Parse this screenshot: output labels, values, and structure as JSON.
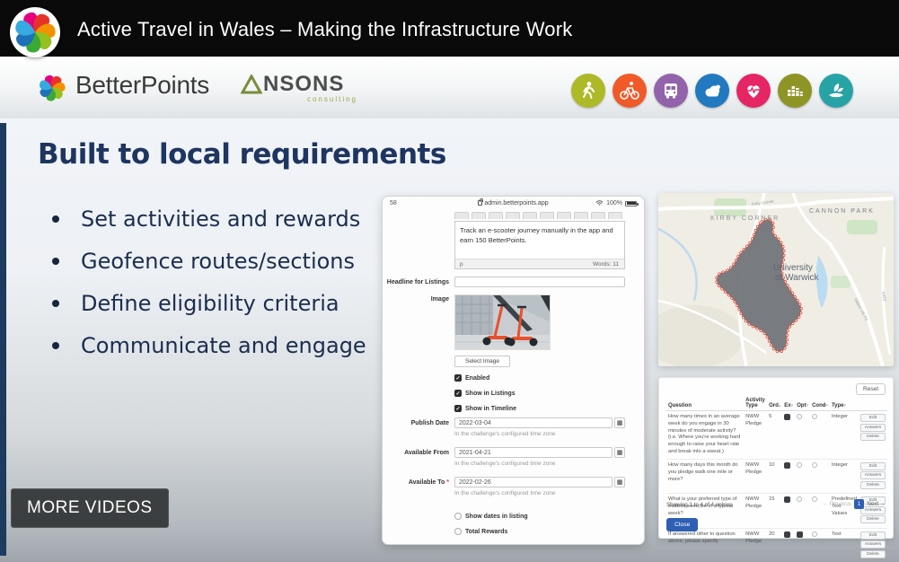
{
  "player": {
    "title": "Active Travel in Wales – Making the Infrastructure Work",
    "more_videos": "MORE VIDEOS"
  },
  "header": {
    "brand": "BetterPoints",
    "partner_rest": "NSONS",
    "partner_sub": "consulting",
    "icons": [
      {
        "name": "walking-icon",
        "color": "#aeb927"
      },
      {
        "name": "cycling-icon",
        "color": "#f05a28"
      },
      {
        "name": "bus-icon",
        "color": "#9263ab"
      },
      {
        "name": "cloud-weather-icon",
        "color": "#2279bf"
      },
      {
        "name": "heart-health-icon",
        "color": "#e62565"
      },
      {
        "name": "bar-chart-icon",
        "color": "#8f9426"
      },
      {
        "name": "eco-leaf-icon",
        "color": "#27a3a6"
      }
    ]
  },
  "slide": {
    "heading": "Built to local requirements",
    "bullets": [
      "Set activities and rewards",
      "Geofence routes/sections",
      "Define eligibility criteria",
      "Communicate and engage"
    ],
    "accent_color": "#1e3560"
  },
  "glyphs": {
    "sort_asc": "▴",
    "sort_desc": "▾",
    "calendar": "▦",
    "check": "✓"
  },
  "admin_form": {
    "status_left": "58",
    "url": "admin.betterpoints.app",
    "battery": "100%",
    "editor_text": "Track an e-scooter journey manually in the app and earn 150 BetterPoints.",
    "editor_path": "p",
    "word_count": "Words: 11",
    "headline_label": "Headline for Listings",
    "headline_value": "",
    "image_label": "Image",
    "select_image_label": "Select Image",
    "checks": [
      {
        "label": "Enabled",
        "checked": true
      },
      {
        "label": "Show in Listings",
        "checked": true
      },
      {
        "label": "Show in Timeline",
        "checked": true
      }
    ],
    "dates": [
      {
        "label": "Publish Date",
        "required": "",
        "value": "2022-03-04",
        "helper": "In the challenge's configured time zone"
      },
      {
        "label": "Available From",
        "required": "",
        "value": "2021-04-21",
        "helper": "In the challenge's configured time zone"
      },
      {
        "label": "Available To",
        "required": "*",
        "value": "2022-02-26",
        "helper": "In the challenge's configured time zone"
      }
    ],
    "bottom_checks": [
      {
        "label": "Show dates in listing",
        "checked": false
      },
      {
        "label": "Total Rewards",
        "checked": false
      }
    ]
  },
  "map": {
    "area_label_1": "KIRBY CORNER",
    "area_label_2": "CANNON PARK",
    "place_line_1": "University",
    "place_line_2": "of Warwick",
    "road_label_1": "Kirby Corner",
    "road_label_2": "Gibbet Hill Rd",
    "road_label_3": "A429",
    "geofence_fill": "#6e7control4",
    "geofence_border": "#e8442e"
  },
  "questions_table": {
    "reset_label": "Reset",
    "columns": [
      "Question",
      "Activity Type",
      "Ord",
      "Ex",
      "Opt",
      "Cond",
      "Type"
    ],
    "rows": [
      {
        "question": "How many times in an average week do you engage in 30 minutes of moderate activity? (i.e. Where you're working hard enough to raise your heart rate and break into a sweat.)",
        "activity": "NWW Pledge",
        "ord": "5",
        "ex": true,
        "opt": false,
        "cond": false,
        "type": "Integer",
        "actions": [
          "Edit",
          "Answers",
          "Delete"
        ]
      },
      {
        "question": "How many days this month do you pledge walk one mile or more?",
        "activity": "NWW Pledge",
        "ord": "10",
        "ex": true,
        "opt": false,
        "cond": false,
        "type": "Integer",
        "actions": [
          "Edit",
          "Answers",
          "Delete"
        ]
      },
      {
        "question": "What is your preferred type of outdoor exercise in a typical week?",
        "activity": "NWW Pledge",
        "ord": "15",
        "ex": true,
        "opt": false,
        "cond": false,
        "type": "Predefined Text Values",
        "actions": [
          "Edit",
          "Answers",
          "Delete"
        ]
      },
      {
        "question": "If answered other to question above, please specify",
        "activity": "NWW Pledge",
        "ord": "20",
        "ex": true,
        "opt": true,
        "cond": false,
        "type": "Text",
        "actions": [
          "Edit",
          "Answers",
          "Delete"
        ]
      }
    ],
    "footer": "Showing 1 to 4 of 4 entries",
    "pagination": {
      "previous": "← Previous",
      "page": "1",
      "next": "Next →"
    },
    "close_label": "Close"
  }
}
